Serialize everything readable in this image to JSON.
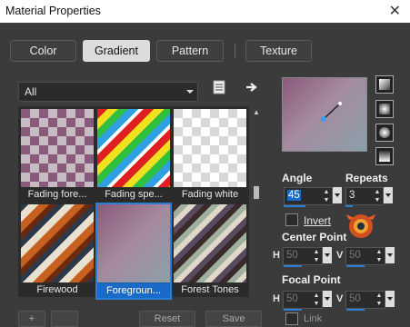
{
  "window": {
    "title": "Material Properties",
    "close_symbol": "✕"
  },
  "tabs": [
    "Color",
    "Gradient",
    "Pattern",
    "Texture"
  ],
  "active_tab": "Gradient",
  "category": {
    "selected": "All"
  },
  "gallery": {
    "items": [
      {
        "label": "Fading fore..."
      },
      {
        "label": "Fading spe..."
      },
      {
        "label": "Fading white"
      },
      {
        "label": "Firewood"
      },
      {
        "label": "Foregroun...",
        "selected": true
      },
      {
        "label": "Forest Tones"
      }
    ]
  },
  "angle": {
    "label": "Angle",
    "value": "45"
  },
  "repeats": {
    "label": "Repeats",
    "value": "3"
  },
  "invert": {
    "label": "Invert",
    "checked": false
  },
  "center_point": {
    "label": "Center Point",
    "h_label": "H",
    "h_value": "50",
    "v_label": "V",
    "v_value": "50"
  },
  "focal_point": {
    "label": "Focal Point",
    "h_label": "H",
    "h_value": "50",
    "v_label": "V",
    "v_value": "50"
  },
  "bottom_buttons": [
    "+",
    "",
    "Reset",
    "Save"
  ],
  "link": {
    "label": "Link"
  },
  "colors": {
    "selection": "#1a6ac8",
    "accent": "#2a7fd4"
  }
}
